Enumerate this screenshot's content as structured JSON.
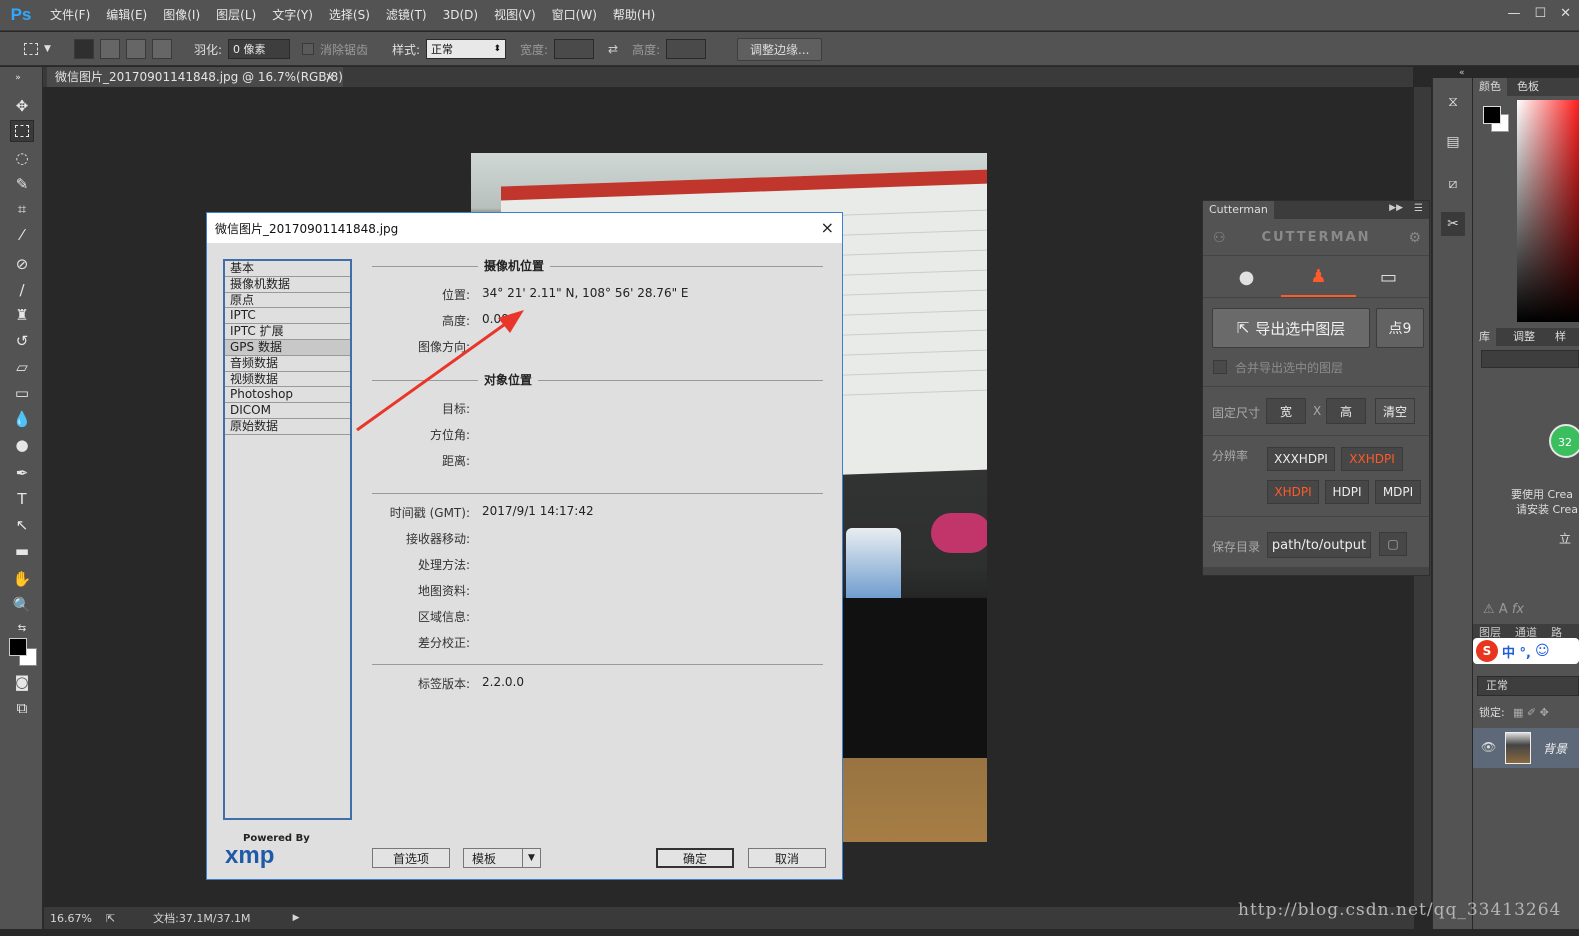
{
  "app": {
    "logo": "Ps"
  },
  "menu": [
    "文件(F)",
    "编辑(E)",
    "图像(I)",
    "图层(L)",
    "文字(Y)",
    "选择(S)",
    "滤镜(T)",
    "3D(D)",
    "视图(V)",
    "窗口(W)",
    "帮助(H)"
  ],
  "options": {
    "feather_label": "羽化:",
    "feather_value": "0 像素",
    "antialias_label": "消除锯齿",
    "style_label": "样式:",
    "style_value": "正常",
    "width_label": "宽度:",
    "height_label": "高度:",
    "refine_edge": "调整边缘..."
  },
  "document_tab": {
    "title": "微信图片_20170901141848.jpg @ 16.7%(RGB/8)",
    "close": "×"
  },
  "status": {
    "zoom": "16.67%",
    "doc_size": "文档:37.1M/37.1M"
  },
  "right_panel": {
    "tab_color": "颜色",
    "tab_swatches": "色板",
    "tab_library": "库",
    "tab_adjust": "调整",
    "tab_style": "样",
    "layers_tabs": [
      "图层",
      "通道",
      "路"
    ],
    "blend_mode": "正常",
    "lock_label": "锁定:",
    "layer_name": "背景",
    "creative_badge": "32",
    "creative_text_1": "要使用 Crea",
    "creative_text_2": "请安装 Crea",
    "creative_text_3": "立",
    "ime_text": "中 °,"
  },
  "cutterman": {
    "tab": "Cutterman",
    "brand": "CUTTERMAN",
    "export_button": "导出选中图层",
    "point9_button": "点9",
    "merge_label": "合并导出选中的图层",
    "fixed_size_label": "固定尺寸",
    "width_btn": "宽",
    "x_label": "X",
    "height_btn": "高",
    "clear_btn": "清空",
    "resolution_label": "分辨率",
    "dpi": [
      "XXXHDPI",
      "XXHDPI",
      "XHDPI",
      "HDPI",
      "MDPI"
    ],
    "save_dir_label": "保存目录",
    "save_dir_value": "path/to/output",
    "accent": "#ff5a2a"
  },
  "dialog": {
    "title": "微信图片_20170901141848.jpg",
    "close": "×",
    "categories": [
      "基本",
      "摄像机数据",
      "原点",
      "IPTC",
      "IPTC 扩展",
      "GPS 数据",
      "音频数据",
      "视频数据",
      "Photoshop",
      "DICOM",
      "原始数据"
    ],
    "selected_category": "GPS 数据",
    "section_camera": "摄像机位置",
    "section_object": "对象位置",
    "fields_camera": [
      {
        "label": "位置:",
        "value": "34° 21' 2.11\" N,  108° 56' 28.76\" E"
      },
      {
        "label": "高度:",
        "value": "0.00"
      },
      {
        "label": "图像方向:",
        "value": ""
      }
    ],
    "fields_object": [
      {
        "label": "目标:",
        "value": ""
      },
      {
        "label": "方位角:",
        "value": ""
      },
      {
        "label": "距离:",
        "value": ""
      }
    ],
    "fields_time": [
      {
        "label": "时间戳 (GMT):",
        "value": "2017/9/1 14:17:42"
      },
      {
        "label": "接收器移动:",
        "value": ""
      },
      {
        "label": "处理方法:",
        "value": ""
      },
      {
        "label": "地图资料:",
        "value": ""
      },
      {
        "label": "区域信息:",
        "value": ""
      },
      {
        "label": "差分校正:",
        "value": ""
      }
    ],
    "fields_version": [
      {
        "label": "标签版本:",
        "value": "2.2.0.0"
      }
    ],
    "xmp_powered": "Powered By",
    "xmp_logo": "xmp",
    "btn_prefs": "首选项",
    "btn_template": "模板",
    "btn_ok": "确定",
    "btn_cancel": "取消"
  },
  "watermark": "http://blog.csdn.net/qq_33413264"
}
